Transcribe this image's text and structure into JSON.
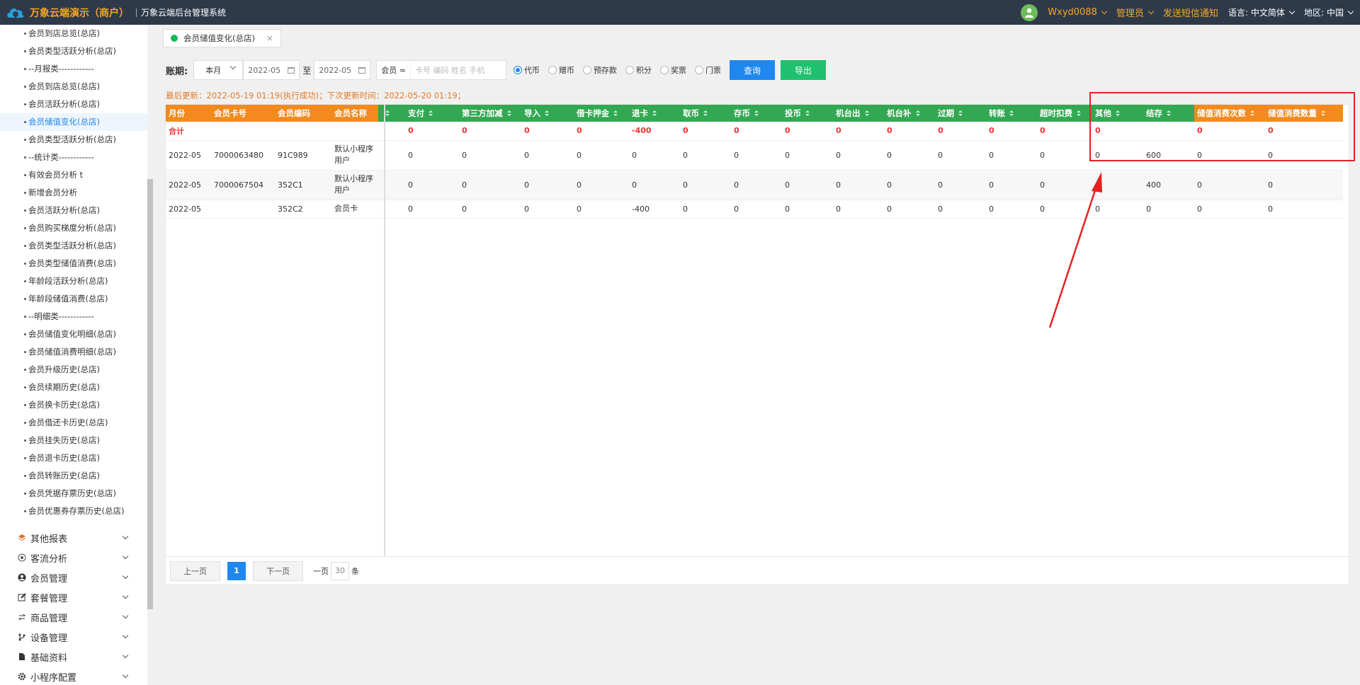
{
  "header": {
    "brand": "万象云端演示（商户）",
    "subtitle": "万象云端后台管理系统",
    "user": "Wxyd0088",
    "role": "管理员",
    "sms": "发送短信通知",
    "lang_label": "语言:",
    "lang_value": "中文简体",
    "region_label": "地区:",
    "region_value": "中国"
  },
  "sidebar": {
    "subitems": [
      "会员到店总览(总店)",
      "会员类型活跃分析(总店)",
      "--月报类------------",
      "会员到店总览(总店)",
      "会员活跃分析(总店)",
      "会员储值变化(总店)",
      "会员类型活跃分析(总店)",
      "--统计类------------",
      "有效会员分析 t",
      "新增会员分析",
      "会员活跃分析(总店)",
      "会员购买梯度分析(总店)",
      "会员类型活跃分析(总店)",
      "会员类型储值消费(总店)",
      "年龄段活跃分析(总店)",
      "年龄段储值消费(总店)",
      "--明细类------------",
      "会员储值变化明细(总店)",
      "会员储值消费明细(总店)",
      "会员升级历史(总店)",
      "会员续期历史(总店)",
      "会员换卡历史(总店)",
      "会员借还卡历史(总店)",
      "会员挂失历史(总店)",
      "会员退卡历史(总店)",
      "会员转账历史(总店)",
      "会员凭据存票历史(总店)",
      "会员优惠券存票历史(总店)"
    ],
    "active_index": 5,
    "groups": [
      {
        "label": "其他报表",
        "icon": "layers-icon"
      },
      {
        "label": "客流分析",
        "icon": "target-icon"
      },
      {
        "label": "会员管理",
        "icon": "user-icon"
      },
      {
        "label": "套餐管理",
        "icon": "edit-icon"
      },
      {
        "label": "商品管理",
        "icon": "refresh-icon"
      },
      {
        "label": "设备管理",
        "icon": "branch-icon"
      },
      {
        "label": "基础资料",
        "icon": "file-icon"
      },
      {
        "label": "小程序配置",
        "icon": "gear-icon"
      }
    ]
  },
  "tab": {
    "label": "会员储值变化(总店)",
    "close": "×"
  },
  "filter": {
    "label": "账期:",
    "period": "本月",
    "date_from": "2022-05",
    "to": "至",
    "date_to": "2022-05",
    "member_key": "会员 ≈",
    "member_placeholder": "卡号 编码 姓名 手机",
    "radios": [
      {
        "label": "代币",
        "checked": true
      },
      {
        "label": "赠币",
        "checked": false
      },
      {
        "label": "预存款",
        "checked": false
      },
      {
        "label": "积分",
        "checked": false
      },
      {
        "label": "奖票",
        "checked": false
      },
      {
        "label": "门票",
        "checked": false
      }
    ],
    "query_button": "查询",
    "export_button": "导出"
  },
  "last_update": "最后更新：2022-05-19 01:19(执行成功)；下次更新时间：2022-05-20 01:19；",
  "table": {
    "columns": [
      {
        "label": "月份",
        "color": "orange",
        "sort": false
      },
      {
        "label": "会员卡号",
        "color": "orange",
        "sort": false
      },
      {
        "label": "会员编码",
        "color": "orange",
        "sort": false
      },
      {
        "label": "会员名称",
        "color": "orange",
        "sort": false
      },
      {
        "label": "",
        "color": "green",
        "sort": true
      },
      {
        "label": "支付",
        "color": "green",
        "sort": true
      },
      {
        "label": "第三方加减",
        "color": "green",
        "sort": true
      },
      {
        "label": "导入",
        "color": "green",
        "sort": true
      },
      {
        "label": "借卡押金",
        "color": "green",
        "sort": true
      },
      {
        "label": "退卡",
        "color": "green",
        "sort": true
      },
      {
        "label": "取币",
        "color": "green",
        "sort": true
      },
      {
        "label": "存币",
        "color": "green",
        "sort": true
      },
      {
        "label": "投币",
        "color": "green",
        "sort": true
      },
      {
        "label": "机台出",
        "color": "green",
        "sort": true
      },
      {
        "label": "机台补",
        "color": "green",
        "sort": true
      },
      {
        "label": "过期",
        "color": "green",
        "sort": true
      },
      {
        "label": "转账",
        "color": "green",
        "sort": true
      },
      {
        "label": "超时扣费",
        "color": "green",
        "sort": true
      },
      {
        "label": "其他",
        "color": "green",
        "sort": true
      },
      {
        "label": "结存",
        "color": "green",
        "sort": true
      },
      {
        "label": "储值消费次数",
        "color": "orange",
        "sort": true
      },
      {
        "label": "储值消费数量",
        "color": "orange",
        "sort": true
      }
    ],
    "summary": [
      "合计",
      "",
      "",
      "",
      "",
      "0",
      "0",
      "0",
      "0",
      "-400",
      "0",
      "0",
      "0",
      "0",
      "0",
      "0",
      "0",
      "0",
      "0",
      "",
      "0",
      "0"
    ],
    "rows": [
      [
        "2022-05",
        "7000063480",
        "91C989",
        "默认小程序用户",
        "",
        "0",
        "0",
        "0",
        "0",
        "0",
        "0",
        "0",
        "0",
        "0",
        "0",
        "0",
        "0",
        "0",
        "0",
        "600",
        "0",
        "0"
      ],
      [
        "2022-05",
        "7000067504",
        "352C1",
        "默认小程序用户",
        "",
        "0",
        "0",
        "0",
        "0",
        "0",
        "0",
        "0",
        "0",
        "0",
        "0",
        "0",
        "0",
        "0",
        "0",
        "400",
        "0",
        "0"
      ],
      [
        "2022-05",
        "",
        "352C2",
        "会员卡",
        "",
        "0",
        "0",
        "0",
        "0",
        "-400",
        "0",
        "0",
        "0",
        "0",
        "0",
        "0",
        "0",
        "0",
        "0",
        "0",
        "0",
        "0"
      ]
    ]
  },
  "pager": {
    "prev": "上一页",
    "current": "1",
    "next": "下一页",
    "per_page_label": "一页",
    "per_page": "30",
    "unit": "条"
  },
  "colors": {
    "topbar": "#2e3a4a",
    "brand": "#f5a623",
    "header_orange": "#f28a1e",
    "header_green": "#32a852",
    "primary": "#1e87f0",
    "export": "#1fc06e",
    "annotation": "#e52222"
  }
}
